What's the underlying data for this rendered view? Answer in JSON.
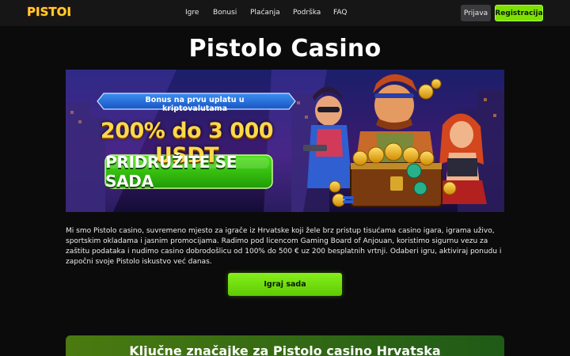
{
  "header": {
    "logo_text": "PISTOLO",
    "nav": [
      {
        "label": "Igre"
      },
      {
        "label": "Bonusi"
      },
      {
        "label": "Plaćanja"
      },
      {
        "label": "Podrška"
      },
      {
        "label": "FAQ"
      }
    ],
    "login_label": "Prijava",
    "register_label": "Registracija"
  },
  "page": {
    "title": "Pistolo Casino"
  },
  "banner": {
    "promo_label": "Bonus na prvu uplatu u kriptovalutama",
    "promo_main": "200% do 3 000 USDT",
    "promo_cta": "PRIDRUŽITE SE SADA"
  },
  "description": "Mi smo Pistolo casino, suvremeno mjesto za igrače iz Hrvatske koji žele brz pristup tisućama casino igara, igrama uživo, sportskim okladama i jasnim promocijama. Radimo pod licencom Gaming Board of Anjouan, koristimo sigurnu vezu za zaštitu podataka i nudimo casino dobrodošlicu od 100% do 500 € uz 200 besplatnih vrtnji. Odaberi igru, aktiviraj ponudu i započni svoje Pistolo iskustvo već danas.",
  "play_button_label": "Igraj sada",
  "features": {
    "title": "Ključne značajke za Pistolo casino Hrvatska"
  },
  "colors": {
    "background": "#0b0b0c",
    "header": "#161616",
    "accent_green": "#7fe100",
    "gold": "#ffd84a"
  }
}
